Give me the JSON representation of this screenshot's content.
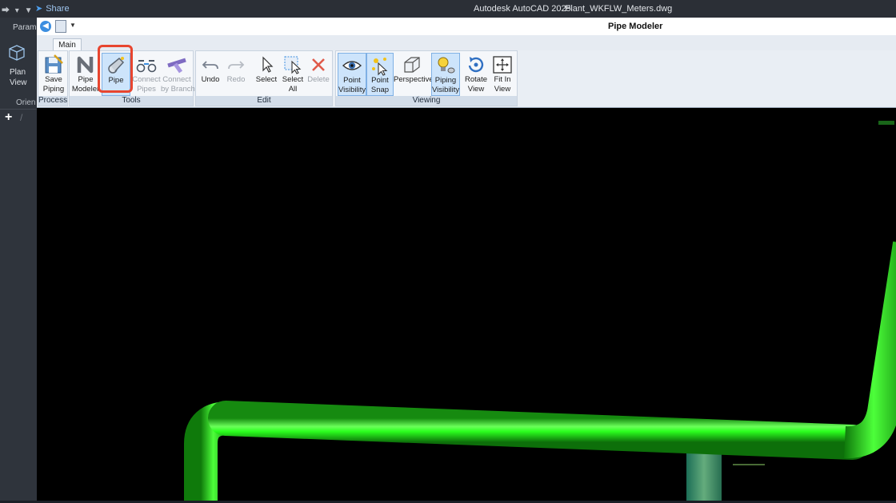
{
  "acad": {
    "quick_access": "⮕ ▾ ▼",
    "share": "Share",
    "app_title": "Autodesk AutoCAD 2025",
    "file_name": "Plant_WKFLW_Meters.dwg"
  },
  "left": {
    "param": "Param",
    "plan_line1": "Plan",
    "plan_line2": "View",
    "orient": "Orien",
    "plus": "+",
    "slash": "/"
  },
  "window": {
    "title": "Pipe Modeler",
    "tab": "Main"
  },
  "ribbon": {
    "groups": [
      "Process",
      "Tools",
      "Edit",
      "Viewing"
    ],
    "buttons": [
      {
        "l1": "Save",
        "l2": "Piping"
      },
      {
        "l1": "Pipe",
        "l2": "Modeler"
      },
      {
        "l1": "Pipe",
        "l2": ""
      },
      {
        "l1": "Connect",
        "l2": "Pipes"
      },
      {
        "l1": "Connect",
        "l2": "by Branch"
      },
      {
        "l1": "Undo",
        "l2": ""
      },
      {
        "l1": "Redo",
        "l2": ""
      },
      {
        "l1": "Select",
        "l2": ""
      },
      {
        "l1": "Select",
        "l2": "All"
      },
      {
        "l1": "Delete",
        "l2": ""
      },
      {
        "l1": "Point",
        "l2": "Visibility"
      },
      {
        "l1": "Point",
        "l2": "Snap"
      },
      {
        "l1": "Perspective",
        "l2": ""
      },
      {
        "l1": "Piping",
        "l2": "Visibility"
      },
      {
        "l1": "Rotate",
        "l2": "View"
      },
      {
        "l1": "Fit In",
        "l2": "View"
      }
    ]
  },
  "colors": {
    "pipe": "#2bff1e",
    "highlight": "#e8452f",
    "accent": "#3c8ee0"
  },
  "state": {
    "active_tool": "Pipe",
    "toggled_on": [
      "Point Visibility",
      "Point Snap",
      "Piping Visibility"
    ]
  }
}
